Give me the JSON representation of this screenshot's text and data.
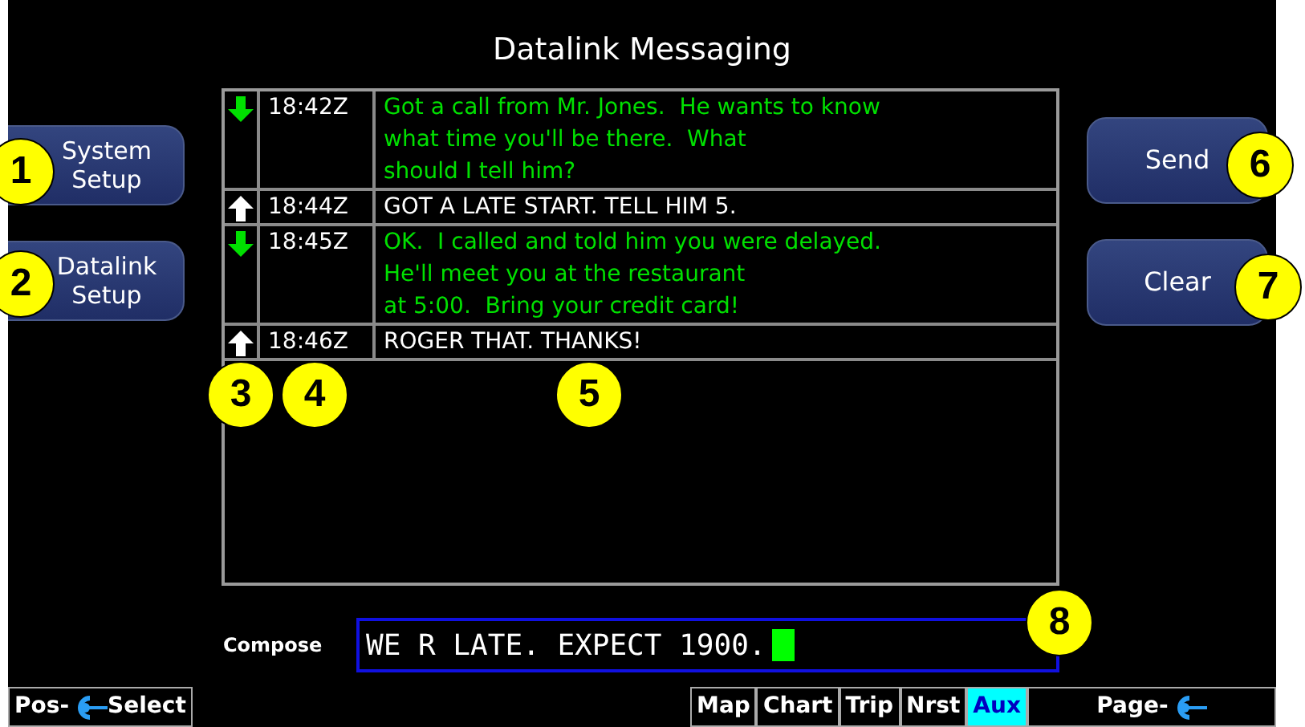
{
  "title": "Datalink Messaging",
  "left_buttons": [
    "System\nSetup",
    "Datalink\nSetup"
  ],
  "messages": [
    {
      "kind": "incoming",
      "time": "18:42Z",
      "text": "Got a call from Mr. Jones.  He wants to know\nwhat time you'll be there.  What\nshould I tell him?"
    },
    {
      "kind": "outgoing",
      "time": "18:44Z",
      "text": "GOT A LATE START. TELL HIM 5."
    },
    {
      "kind": "incoming",
      "time": "18:45Z",
      "text": "OK.  I called and told him you were delayed.\nHe'll meet you at the restaurant\nat 5:00.  Bring your credit card!"
    },
    {
      "kind": "outgoing",
      "time": "18:46Z",
      "text": "ROGER THAT. THANKS!"
    }
  ],
  "right_buttons": [
    "Send",
    "Clear"
  ],
  "compose": {
    "label": "Compose",
    "value": "WE R LATE. EXPECT 1900."
  },
  "footer": {
    "left": {
      "before": "Pos-",
      "after": "Select"
    },
    "softkeys": [
      {
        "label": "Map",
        "selected": false
      },
      {
        "label": "Chart",
        "selected": false
      },
      {
        "label": "Trip",
        "selected": false
      },
      {
        "label": "Nrst",
        "selected": false
      },
      {
        "label": "Aux",
        "selected": true
      }
    ],
    "right": {
      "before": "Page-"
    }
  },
  "callouts": [
    "1",
    "2",
    "3",
    "4",
    "5",
    "6",
    "7",
    "8"
  ]
}
